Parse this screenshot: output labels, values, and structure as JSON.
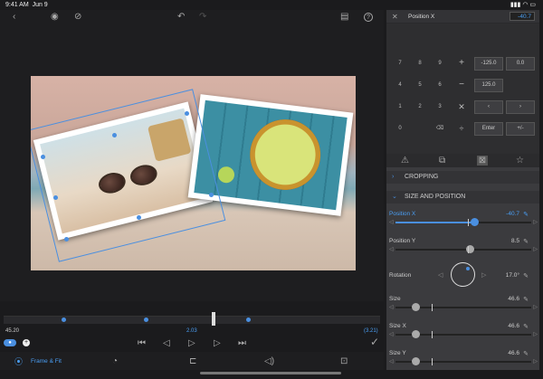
{
  "status": {
    "time": "9:41 AM",
    "date": "Jun 9"
  },
  "toolbar": {
    "back_icon": "chevron-left-icon",
    "eye_icon": "eye-icon",
    "eye_hidden_icon": "eye-slash-icon",
    "undo_icon": "undo-icon",
    "redo_icon": "redo-icon",
    "library_icon": "library-icon",
    "help_icon": "help-icon"
  },
  "timeline": {
    "time_left": "45.20",
    "time_center": "2.03",
    "time_right": "(3.21)"
  },
  "tabs": [
    {
      "label": "Frame & Fit",
      "icon": "frame-fit-icon",
      "active": true
    },
    {
      "label": "",
      "icon": "clock-icon"
    },
    {
      "label": "",
      "icon": "crop-icon"
    },
    {
      "label": "",
      "icon": "speaker-icon"
    },
    {
      "label": "",
      "icon": "transform-icon"
    }
  ],
  "panel": {
    "title": "Position X",
    "value": "-40.7",
    "keypad": {
      "rows": [
        [
          "7",
          "8",
          "9"
        ],
        [
          "4",
          "5",
          "6"
        ],
        [
          "1",
          "2",
          "3"
        ],
        [
          "0",
          "",
          "⌫"
        ]
      ],
      "fields": [
        "-125.0",
        "0.0",
        "125.0"
      ],
      "enter": "Enter",
      "plusminus": "+/-"
    },
    "sections": {
      "cropping": "CROPPING",
      "size_position": "SIZE AND POSITION"
    },
    "params": [
      {
        "label": "Position X",
        "value": "-40.7",
        "level": 0.58,
        "active": true
      },
      {
        "label": "Position Y",
        "value": "8.5",
        "level": 0.55
      },
      {
        "label": "Rotation",
        "value": "17.0°"
      },
      {
        "label": "Size",
        "value": "46.6",
        "level": 0.15
      },
      {
        "label": "Size X",
        "value": "46.6",
        "level": 0.15
      },
      {
        "label": "Size Y",
        "value": "46.6",
        "level": 0.15
      }
    ]
  },
  "colors": {
    "accent": "#4a8fe0",
    "panel": "#3b3b3e",
    "background": "#1e1e20"
  }
}
